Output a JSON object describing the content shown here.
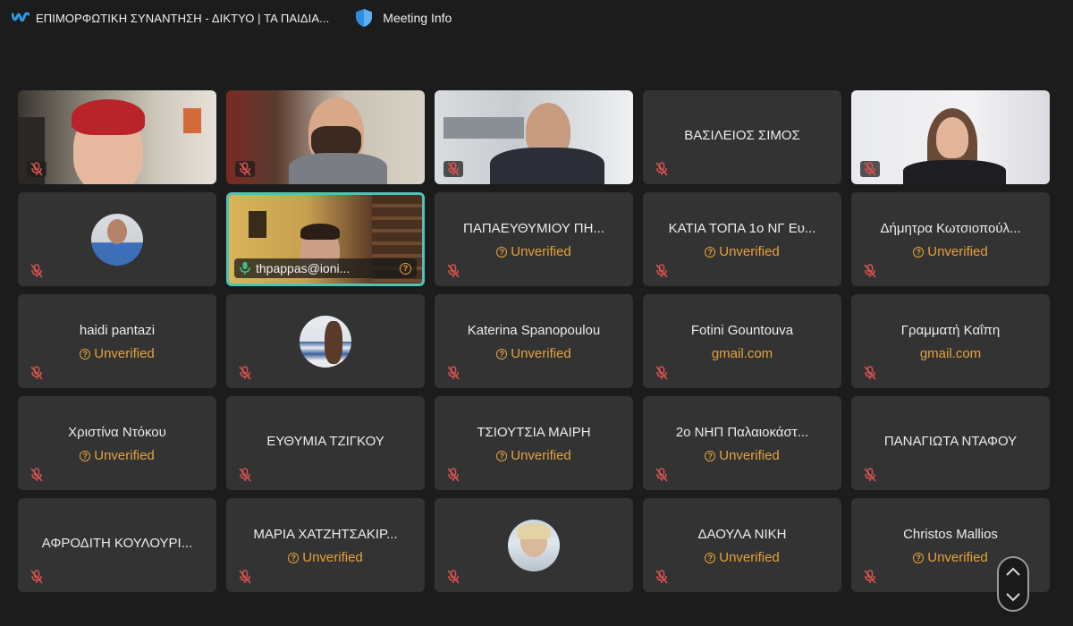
{
  "window": {
    "title": "ΕΠΙΜΟΡΦΩΤΙΚΗ ΣΥΝΑΝΤΗΣΗ - ΔΙΚΤΥΟ | ΤΑ ΠΑΙΔΙΑ...",
    "app_icon": "webex-logo-icon",
    "meeting_info_label": "Meeting Info",
    "meeting_info_icon": "shield-icon"
  },
  "colors": {
    "background": "#1c1c1c",
    "tile": "#333333",
    "unverified": "#e6a23c",
    "active_speaker_border": "#4fc3b5",
    "muted_icon": "#d9534f"
  },
  "participants": [
    {
      "name": "",
      "video": true,
      "muted": true
    },
    {
      "name": "",
      "video": true,
      "muted": true
    },
    {
      "name": "",
      "video": true,
      "muted": true
    },
    {
      "name": "ΒΑΣΙΛΕΙΟΣ ΣΙΜΟΣ",
      "status": "",
      "muted": true
    },
    {
      "name": "",
      "video": true,
      "muted": true
    },
    {
      "name": "",
      "avatar": true,
      "muted": true
    },
    {
      "name": "thpappas@ioni...",
      "video": true,
      "active_speaker": true,
      "unmuted": true
    },
    {
      "name": "ΠΑΠΑΕΥΘΥΜΙΟΥ ΠΗ...",
      "status": "Unverified",
      "muted": true
    },
    {
      "name": "ΚΑΤΙΑ ΤΟΠΑ 1ο ΝΓ Ευ...",
      "status": "Unverified",
      "muted": true
    },
    {
      "name": "Δήμητρα Κωτσιοπούλ...",
      "status": "Unverified",
      "muted": true
    },
    {
      "name": "haidi pantazi",
      "status": "Unverified",
      "muted": true
    },
    {
      "name": "",
      "avatar": true,
      "muted": true
    },
    {
      "name": "Katerina Spanopoulou",
      "status": "Unverified",
      "muted": true
    },
    {
      "name": "Fotini Gountouva",
      "status": "gmail.com",
      "muted": true
    },
    {
      "name": "Γραμματή Καΐπη",
      "status": "gmail.com",
      "muted": true
    },
    {
      "name": "Χριστίνα Ντόκου",
      "status": "Unverified",
      "muted": true
    },
    {
      "name": "ΕΥΘΥΜΙΑ ΤΖΙΓΚΟΥ",
      "status": "",
      "muted": true
    },
    {
      "name": "ΤΣΙΟΥΤΣΙΑ ΜΑΙΡΗ",
      "status": "Unverified",
      "muted": true
    },
    {
      "name": "2ο ΝΗΠ Παλαιοκάστ...",
      "status": "Unverified",
      "muted": true
    },
    {
      "name": "ΠΑΝΑΓΙΩΤΑ ΝΤΑΦΟΥ",
      "status": "",
      "muted": true
    },
    {
      "name": "ΑΦΡΟΔΙΤΗ ΚΟΥΛΟΥΡΙ...",
      "status": "",
      "muted": true
    },
    {
      "name": "ΜΑΡΙΑ ΧΑΤΖΗΤΣΑΚΙΡ...",
      "status": "Unverified",
      "muted": true
    },
    {
      "name": "",
      "avatar": true,
      "muted": true
    },
    {
      "name": "ΔΑΟΥΛΑ ΝΙΚΗ",
      "status": "Unverified",
      "muted": true
    },
    {
      "name": "Christos Mallios",
      "status": "Unverified",
      "muted": true
    }
  ]
}
